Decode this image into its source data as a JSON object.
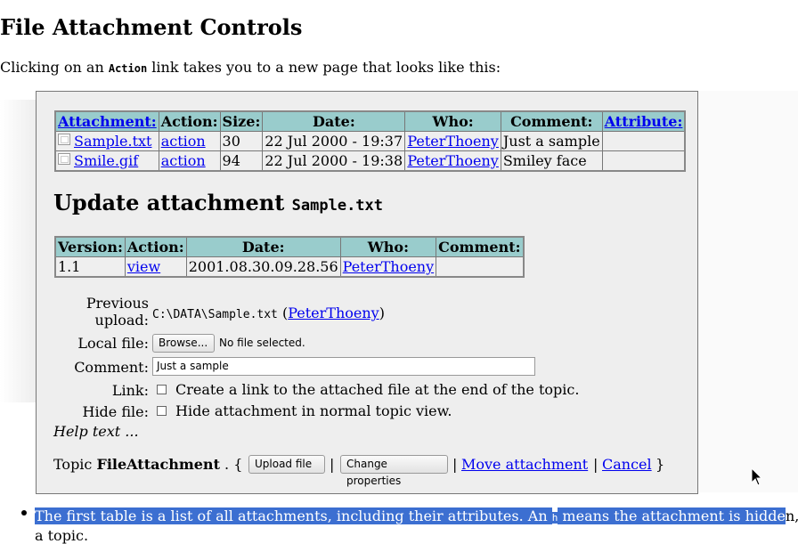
{
  "page": {
    "title": "File Attachment Controls",
    "intro_before": "Clicking on an ",
    "intro_code": "Action",
    "intro_after": " link takes you to a new page that looks like this:"
  },
  "attachments": {
    "headers": [
      "Attachment:",
      "Action:",
      "Size:",
      "Date:",
      "Who:",
      "Comment:",
      "Attribute:"
    ],
    "rows": [
      {
        "name": "Sample.txt",
        "action": "action",
        "size": "30",
        "date": "22 Jul 2000 - 19:37",
        "who": "PeterThoeny",
        "comment": "Just a sample",
        "attribute": ""
      },
      {
        "name": "Smile.gif",
        "action": "action",
        "size": "94",
        "date": "22 Jul 2000 - 19:38",
        "who": "PeterThoeny",
        "comment": "Smiley face",
        "attribute": ""
      }
    ]
  },
  "update": {
    "heading": "Update attachment",
    "file_code": "Sample.txt"
  },
  "versions": {
    "headers": [
      "Version:",
      "Action:",
      "Date:",
      "Who:",
      "Comment:"
    ],
    "rows": [
      {
        "version": "1.1",
        "action": "view",
        "date": "2001.08.30.09.28.56",
        "who": "PeterThoeny",
        "comment": ""
      }
    ]
  },
  "form": {
    "prev_label_line1": "Previous",
    "prev_label_line2": "upload:",
    "prev_path": "C:\\DATA\\Sample.txt",
    "prev_open": " (",
    "prev_who": "PeterThoeny",
    "prev_close": ")",
    "local_label": "Local file:",
    "browse_label": "Browse...",
    "no_file_text": "No file selected.",
    "comment_label": "Comment:",
    "comment_value": "Just a sample",
    "link_label": "Link:",
    "link_text": "Create a link to the attached file at the end of the topic.",
    "hide_label": "Hide file:",
    "hide_text": "Hide attachment in normal topic view.",
    "help_text": "Help text ..."
  },
  "actions": {
    "topic_word": "Topic ",
    "topic_name": "FileAttachment",
    "open_brace": " . { ",
    "upload_label": "Upload file",
    "sep": " | ",
    "change_label": "Change properties",
    "move_label": "Move attachment",
    "cancel_label": "Cancel",
    "close_brace": " }"
  },
  "bullet": {
    "text_before": "The first table is a list of all attachments, including their attributes. An ",
    "code": "h",
    "text_selected_after": " means the attachment is hidde",
    "text_after": "n,",
    "line2": "a topic."
  }
}
